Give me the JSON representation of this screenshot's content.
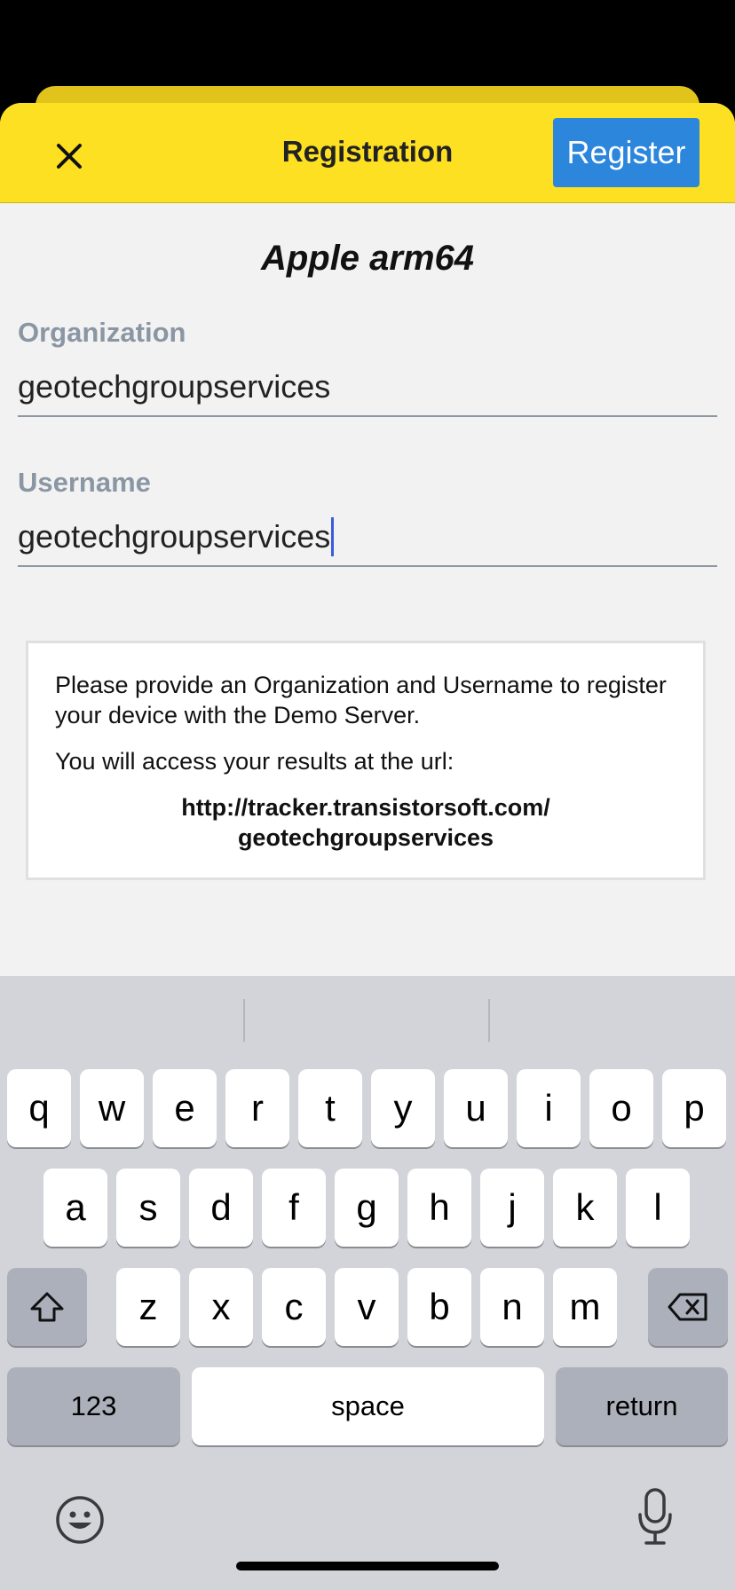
{
  "header": {
    "title": "Registration",
    "register_label": "Register",
    "close_icon": "close-icon"
  },
  "device_name": "Apple arm64",
  "form": {
    "organization": {
      "label": "Organization",
      "value": "geotechgroupservices"
    },
    "username": {
      "label": "Username",
      "value": "geotechgroupservices"
    }
  },
  "info": {
    "line1": "Please provide an Organization and Username to register your device with the Demo Server.",
    "line2": "You will access your results at the url:",
    "url_line1": "http://tracker.transistorsoft.com/",
    "url_line2": "geotechgroupservices"
  },
  "keyboard": {
    "row1": [
      "q",
      "w",
      "e",
      "r",
      "t",
      "y",
      "u",
      "i",
      "o",
      "p"
    ],
    "row2": [
      "a",
      "s",
      "d",
      "f",
      "g",
      "h",
      "j",
      "k",
      "l"
    ],
    "row3": [
      "z",
      "x",
      "c",
      "v",
      "b",
      "n",
      "m"
    ],
    "numbers_label": "123",
    "space_label": "space",
    "return_label": "return"
  },
  "colors": {
    "header_bg": "#fde021",
    "register_bg": "#2b86dc",
    "caret": "#3b5bdb"
  }
}
